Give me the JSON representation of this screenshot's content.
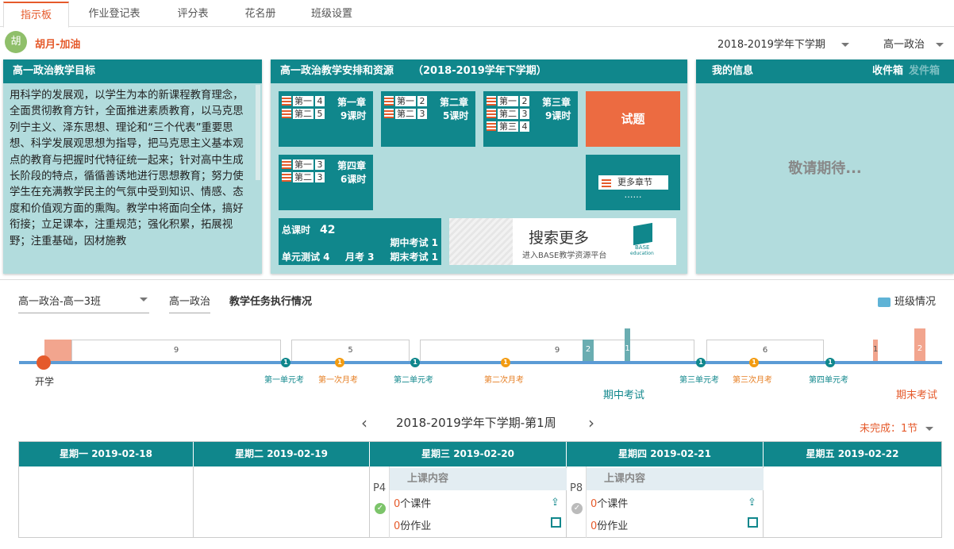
{
  "tabs": [
    "指示板",
    "作业登记表",
    "评分表",
    "花名册",
    "班级设置"
  ],
  "user": {
    "avatar_char": "胡",
    "name": "胡月-加油"
  },
  "term_select": "2018-2019学年下学期",
  "subject_select": "高一政治",
  "goal_panel": {
    "title": "高一政治教学目标",
    "text": "用科学的发展观，以学生为本的新课程教育理念，全面贯彻教育方针，全面推进素质教育，以马克思列宁主义、泽东思想、理论和“三个代表”重要思想、科学发展观思想为指导，把马克思主义基本观点的教育与把握时代特征统一起来；针对高中生成长阶段的特点，循循善诱地进行思想教育；努力使学生在充满教学民主的气氛中受到知识、情感、态度和价值观方面的熏陶。教学中将面向全体，搞好衔接；立足课本，注重规范；强化积累，拓展视野；注重基础，因材施教"
  },
  "plan_panel": {
    "title": "高一政治教学安排和资源",
    "term": "（2018-2019学年下学期）",
    "chapters": [
      {
        "title": "第一章",
        "hours": "9课时",
        "rows": [
          {
            "label": "第一",
            "n": "4"
          },
          {
            "label": "第二",
            "n": "5"
          }
        ]
      },
      {
        "title": "第二章",
        "hours": "5课时",
        "rows": [
          {
            "label": "第一",
            "n": "2"
          },
          {
            "label": "第二",
            "n": "3"
          }
        ]
      },
      {
        "title": "第三章",
        "hours": "9课时",
        "rows": [
          {
            "label": "第一",
            "n": "2"
          },
          {
            "label": "第二",
            "n": "3"
          },
          {
            "label": "第三",
            "n": "4"
          }
        ]
      },
      {
        "title": "第四章",
        "hours": "6课时",
        "rows": [
          {
            "label": "第一",
            "n": "3"
          },
          {
            "label": "第二",
            "n": "3"
          }
        ]
      }
    ],
    "exam_button": "试题",
    "more_chapters": "更多章节",
    "more_dots": "……",
    "summary": {
      "total_label": "总课时",
      "total_value": "42",
      "midterm": "期中考试 1",
      "unit": "单元测试 4",
      "monthly": "月考 3",
      "final": "期末考试 1"
    },
    "search_banner": {
      "title": "搜索更多",
      "sub": "进入BASE教学资源平台",
      "logo_text": "BASE",
      "logo_sub": "education"
    }
  },
  "info_panel": {
    "title": "我的信息",
    "inbox": "收件箱",
    "outbox": "发件箱",
    "body": "敬请期待..."
  },
  "controls": {
    "class_select": "高一政治-高一3班",
    "subject": "高一政治",
    "task_label": "教学任务执行情况",
    "class_info": "班级情况"
  },
  "timeline": {
    "start_label": "开学",
    "segments": [
      "9",
      "5",
      "9",
      "6"
    ],
    "midterm_bars": [
      "2",
      "1"
    ],
    "final_bars": [
      "1",
      "2"
    ],
    "markers": [
      {
        "n": "1",
        "label": "第一单元考",
        "type": "unit"
      },
      {
        "n": "1",
        "label": "第一次月考",
        "type": "month"
      },
      {
        "n": "1",
        "label": "第二单元考",
        "type": "unit"
      },
      {
        "n": "1",
        "label": "第二次月考",
        "type": "month"
      },
      {
        "n": "1",
        "label": "第三单元考",
        "type": "unit"
      },
      {
        "n": "1",
        "label": "第三次月考",
        "type": "month"
      },
      {
        "n": "1",
        "label": "第四单元考",
        "type": "unit"
      }
    ],
    "midterm_label": "期中考试",
    "final_label": "期末考试"
  },
  "week": {
    "title": "2018-2019学年下学期-第1周",
    "prev": "‹",
    "next": "›",
    "incomplete": "未完成：1节"
  },
  "calendar": {
    "days": [
      "星期一 2019-02-18",
      "星期二 2019-02-19",
      "星期三 2019-02-20",
      "星期四 2019-02-21",
      "星期五 2019-02-22"
    ],
    "lessons": [
      {
        "period": "P4",
        "title": "上课内容",
        "courseware_count": "0",
        "courseware_label": "个课件",
        "homework_count": "0",
        "homework_label": "份作业",
        "done": true
      },
      {
        "period": "P8",
        "title": "上课内容",
        "courseware_count": "0",
        "courseware_label": "个课件",
        "homework_count": "0",
        "homework_label": "份作业",
        "done": false
      }
    ]
  },
  "colors": {
    "accent": "#e55a2b",
    "teal": "#10878c",
    "panel_bg": "#b2dcdd",
    "axis": "#5b9bd5"
  }
}
